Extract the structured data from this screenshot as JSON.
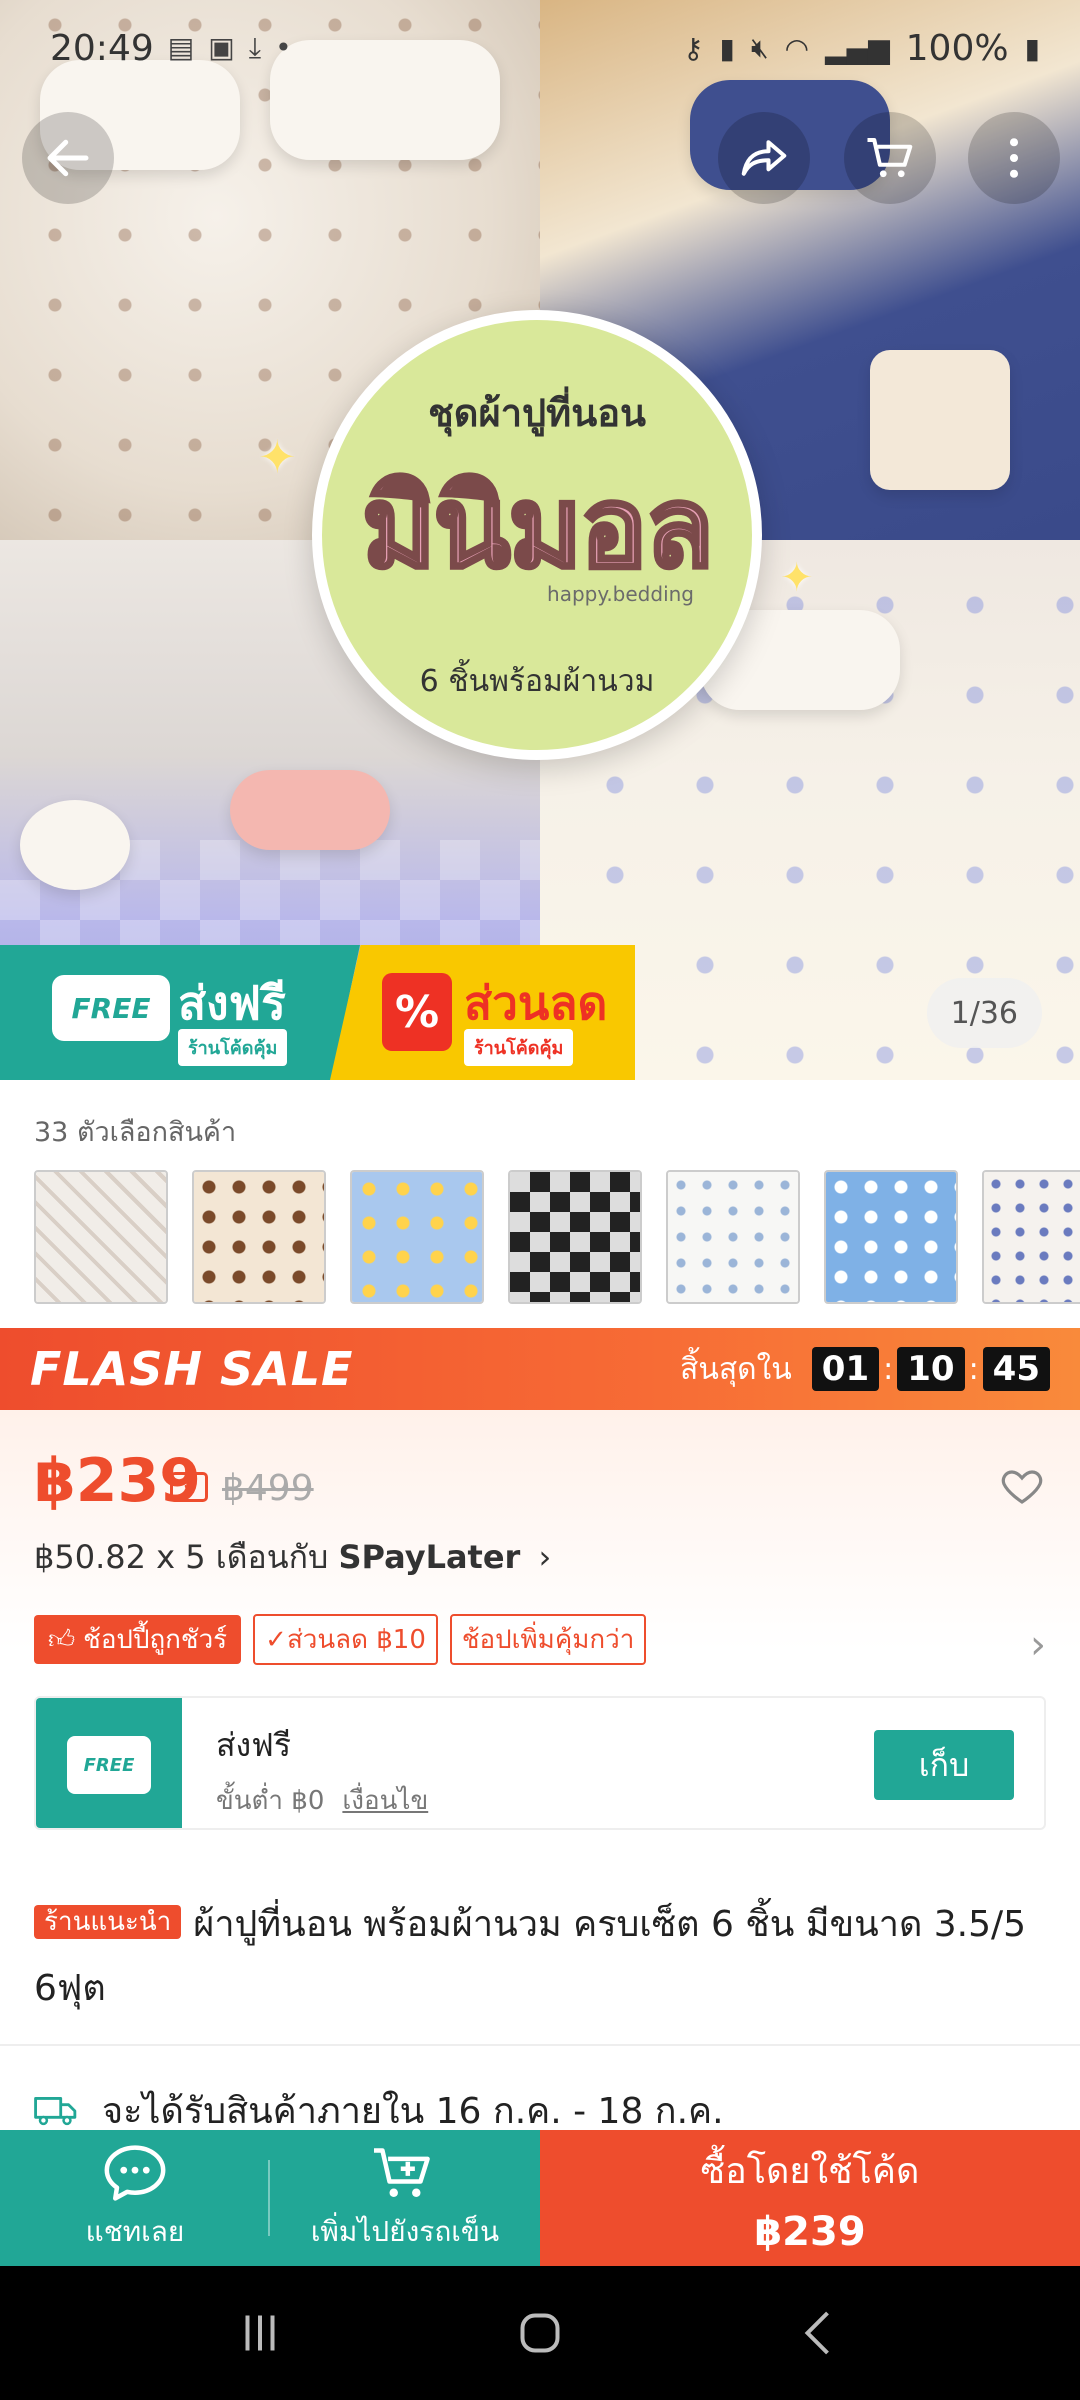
{
  "status_bar": {
    "time": "20:49",
    "battery": "100%",
    "icons": [
      "doc-icon",
      "image-icon",
      "download-icon",
      "dot-icon",
      "key-icon",
      "battery-saver-icon",
      "mute-icon",
      "wifi-icon",
      "signal-icon",
      "battery-icon"
    ]
  },
  "hero": {
    "circle_heading": "ชุดผ้าปูที่นอน",
    "circle_big": "มินิมอล",
    "circle_brand": "happy.bedding",
    "circle_sub": "6 ชิ้นพร้อมผ้านวม",
    "banner_free_badge": "FREE",
    "banner_free_title": "ส่งฟรี",
    "banner_free_tag": "ร้านโค้ดคุ้ม",
    "banner_discount_title": "ส่วนลด",
    "banner_discount_tag": "ร้านโค้ดคุ้ม",
    "banner_discount_icon": "%",
    "image_counter": "1/36"
  },
  "variations": {
    "label": "33 ตัวเลือกสินค้า",
    "thumbnails": [
      "variation-1",
      "variation-2",
      "variation-3",
      "variation-4",
      "variation-5",
      "variation-6",
      "variation-7"
    ]
  },
  "flash_sale": {
    "title": "FLASH SALE",
    "ends_in": "สิ้นสุดใน",
    "hours": "01",
    "minutes": "10",
    "seconds": "45"
  },
  "price": {
    "current": "฿239",
    "original": "฿499",
    "installment_prefix": "฿50.82 x 5 เดือนกับ ",
    "installment_brand": "SPayLater",
    "tags": {
      "guarantee": "ช้อปปี้ถูกชัวร์",
      "discount": "ส่วนลด ฿10",
      "more": "ช้อปเพิ่มคุ้มกว่า"
    }
  },
  "voucher": {
    "badge": "FREE",
    "title": "ส่งฟรี",
    "min_spend": "ขั้นต่ำ ฿0",
    "conditions": "เงื่อนไข",
    "claim_button": "เก็บ"
  },
  "product": {
    "badge": "ร้านแนะนำ",
    "title": "ผ้าปูที่นอน พร้อมผ้านวม ครบเซ็ต 6 ชิ้น มีขนาด 3.5/5 6ฟุต"
  },
  "shipping": {
    "text": "จะได้รับสินค้าภายใน 16 ก.ค. - 18 ก.ค."
  },
  "bottom_bar": {
    "chat_label": "แชทเลย",
    "add_to_cart_label": "เพิ่มไปยังรถเข็น",
    "buy_label": "ซื้อโดยใช้โค้ด",
    "buy_price": "฿239"
  },
  "colors": {
    "shopee_orange": "#ee4d2d",
    "teal": "#21a796",
    "flash_black": "#111111"
  }
}
